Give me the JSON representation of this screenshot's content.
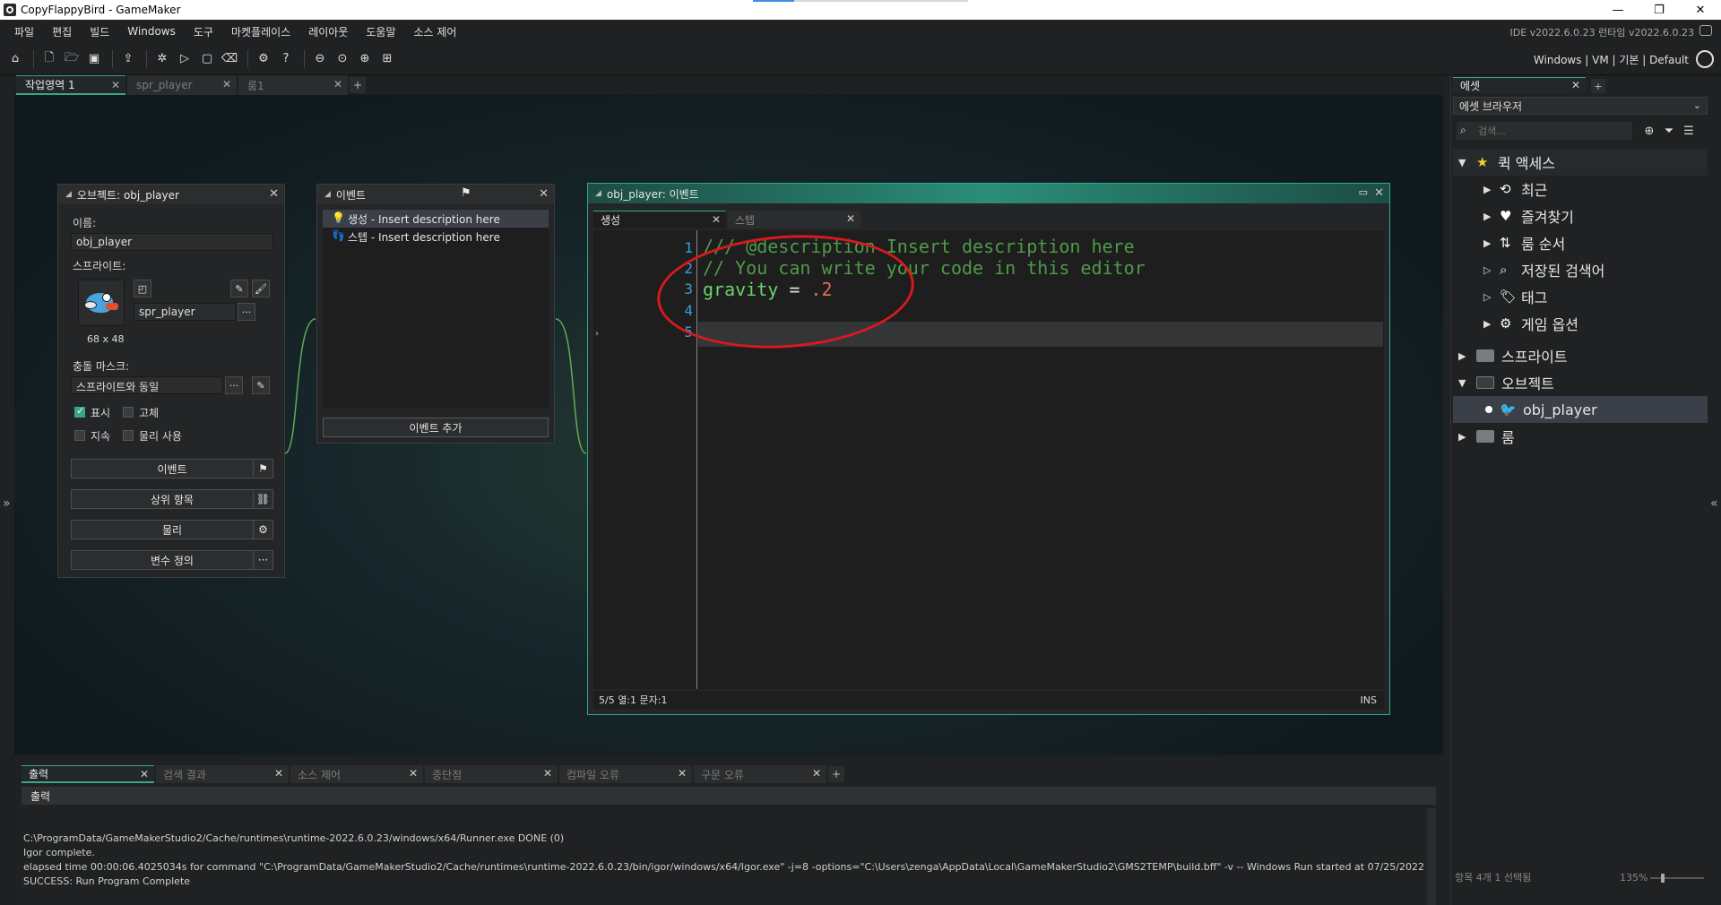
{
  "titlebar": {
    "title": "CopyFlappyBird - GameMaker",
    "minimize": "—",
    "restore": "❐",
    "close": "✕"
  },
  "menu": {
    "items": [
      "파일",
      "편집",
      "빌드",
      "Windows",
      "도구",
      "마켓플레이스",
      "레이아웃",
      "도움말",
      "소스 제어"
    ],
    "ide_version": "IDE v2022.6.0.23  런타임 v2022.6.0.23"
  },
  "toolbar": {
    "target_text": "Windows | VM | 기본 | Default"
  },
  "workspace_tabs": [
    {
      "label": "작업영역 1",
      "active": true
    },
    {
      "label": "spr_player",
      "active": false
    },
    {
      "label": "룸1",
      "active": false
    }
  ],
  "object_panel": {
    "title": "오브젝트: obj_player",
    "name_label": "이름:",
    "name_value": "obj_player",
    "sprite_label": "스프라이트:",
    "sprite_value": "spr_player",
    "sprite_size": "68 x 48",
    "mask_label": "충돌 마스크:",
    "mask_value": "스프라이트와 동일",
    "checkboxes": [
      {
        "label": "표시",
        "checked": true
      },
      {
        "label": "고체",
        "checked": false
      },
      {
        "label": "지속",
        "checked": false
      },
      {
        "label": "물리 사용",
        "checked": false
      }
    ],
    "buttons": [
      "이벤트",
      "상위 항목",
      "물리",
      "변수 정의"
    ]
  },
  "events_panel": {
    "title": "이벤트",
    "events": [
      {
        "label": "생성 - Insert description here",
        "selected": true,
        "icon": "lightbulb-icon"
      },
      {
        "label": "스텝 - Insert description here",
        "selected": false,
        "icon": "footsteps-icon"
      }
    ],
    "add_button": "이벤트 추가"
  },
  "code_panel": {
    "title": "obj_player: 이벤트",
    "tabs": [
      {
        "label": "생성",
        "active": true
      },
      {
        "label": "스텝",
        "active": false
      }
    ],
    "line_numbers": [
      "1",
      "2",
      "3",
      "4",
      "5"
    ],
    "lines": {
      "l1": "/// @description Insert description here",
      "l2": "// You can write your code in this editor",
      "l3_var": "gravity",
      "l3_op": " = ",
      "l3_num": ".2"
    },
    "status": "5/5 열:1 문자:1",
    "mode": "INS"
  },
  "asset_panel": {
    "tab_label": "에셋",
    "browser_label": "에셋 브라우저",
    "search_placeholder": "검색...",
    "quick_access": "퀵 액세스",
    "quick_items": [
      "최근",
      "즐겨찾기",
      "룸 순서",
      "저장된 검색어",
      "태그",
      "게임 옵션"
    ],
    "groups": [
      "스프라이트",
      "오브젝트",
      "룸"
    ],
    "object_item": "obj_player",
    "footer_count": "항목 4개  1 선택됨",
    "footer_zoom": "135%"
  },
  "output": {
    "tabs": [
      {
        "label": "출력",
        "active": true
      },
      {
        "label": "검색 결과",
        "active": false
      },
      {
        "label": "소스 제어",
        "active": false
      },
      {
        "label": "중단점",
        "active": false
      },
      {
        "label": "컴파일 오류",
        "active": false
      },
      {
        "label": "구문 오류",
        "active": false
      }
    ],
    "header": "출력",
    "lines": [
      "C:\\ProgramData/GameMakerStudio2/Cache/runtimes\\runtime-2022.6.0.23/windows/x64/Runner.exe DONE (0)",
      "Igor complete.",
      "elapsed time 00:00:06.4025034s for command \"C:\\ProgramData/GameMakerStudio2/Cache/runtimes\\runtime-2022.6.0.23/bin/igor/windows/x64/Igor.exe\" -j=8 -options=\"C:\\Users\\zenga\\AppData\\Local\\GameMakerStudio2\\GMS2TEMP\\build.bff\" -v -- Windows Run started at 07/25/2022",
      "SUCCESS: Run Program Complete"
    ]
  },
  "colors": {
    "accent": "#3aa48c",
    "annotation_red": "#d8191e"
  }
}
